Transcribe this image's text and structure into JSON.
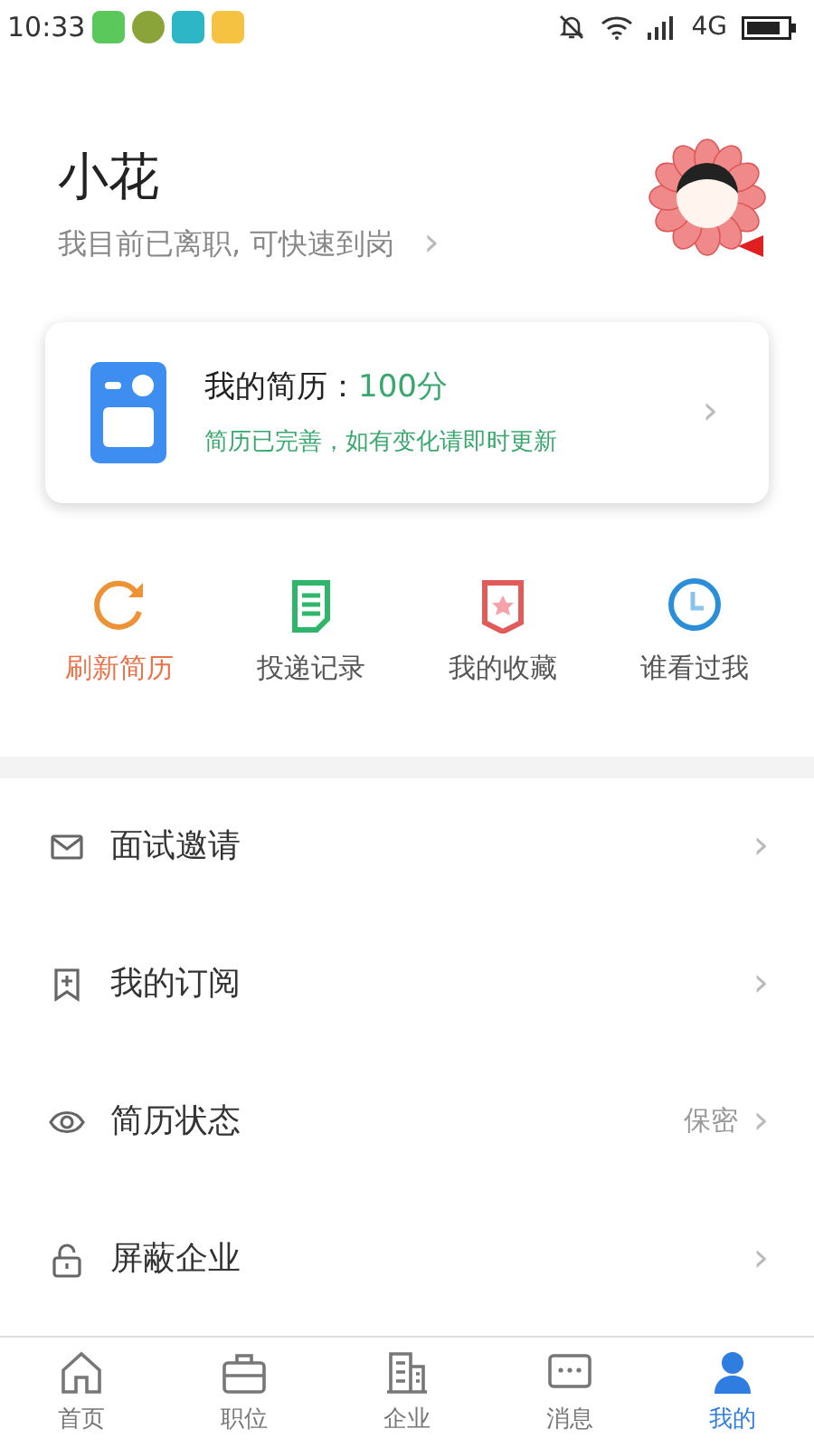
{
  "status_bar": {
    "time": "10:33",
    "network": "4G"
  },
  "profile": {
    "name": "小花",
    "status": "我目前已离职, 可快速到岗",
    "chevron": "›"
  },
  "resume_card": {
    "label": "我的简历：",
    "score": "100分",
    "note": "简历已完善，如有变化请即时更新",
    "chevron": "›"
  },
  "actions": [
    {
      "label": "刷新简历",
      "selected": true
    },
    {
      "label": "投递记录",
      "selected": false
    },
    {
      "label": "我的收藏",
      "selected": false
    },
    {
      "label": "谁看过我",
      "selected": false
    }
  ],
  "menu": [
    {
      "label": "面试邀请",
      "chevron": "›"
    },
    {
      "label": "我的订阅",
      "chevron": "›"
    },
    {
      "label": "简历状态",
      "value": "保密",
      "chevron": "›"
    },
    {
      "label": "屏蔽企业",
      "chevron": "›"
    }
  ],
  "bottom_nav": [
    {
      "label": "首页",
      "selected": false
    },
    {
      "label": "职位",
      "selected": false
    },
    {
      "label": "企业",
      "selected": false
    },
    {
      "label": "消息",
      "selected": false
    },
    {
      "label": "我的",
      "selected": true
    }
  ]
}
